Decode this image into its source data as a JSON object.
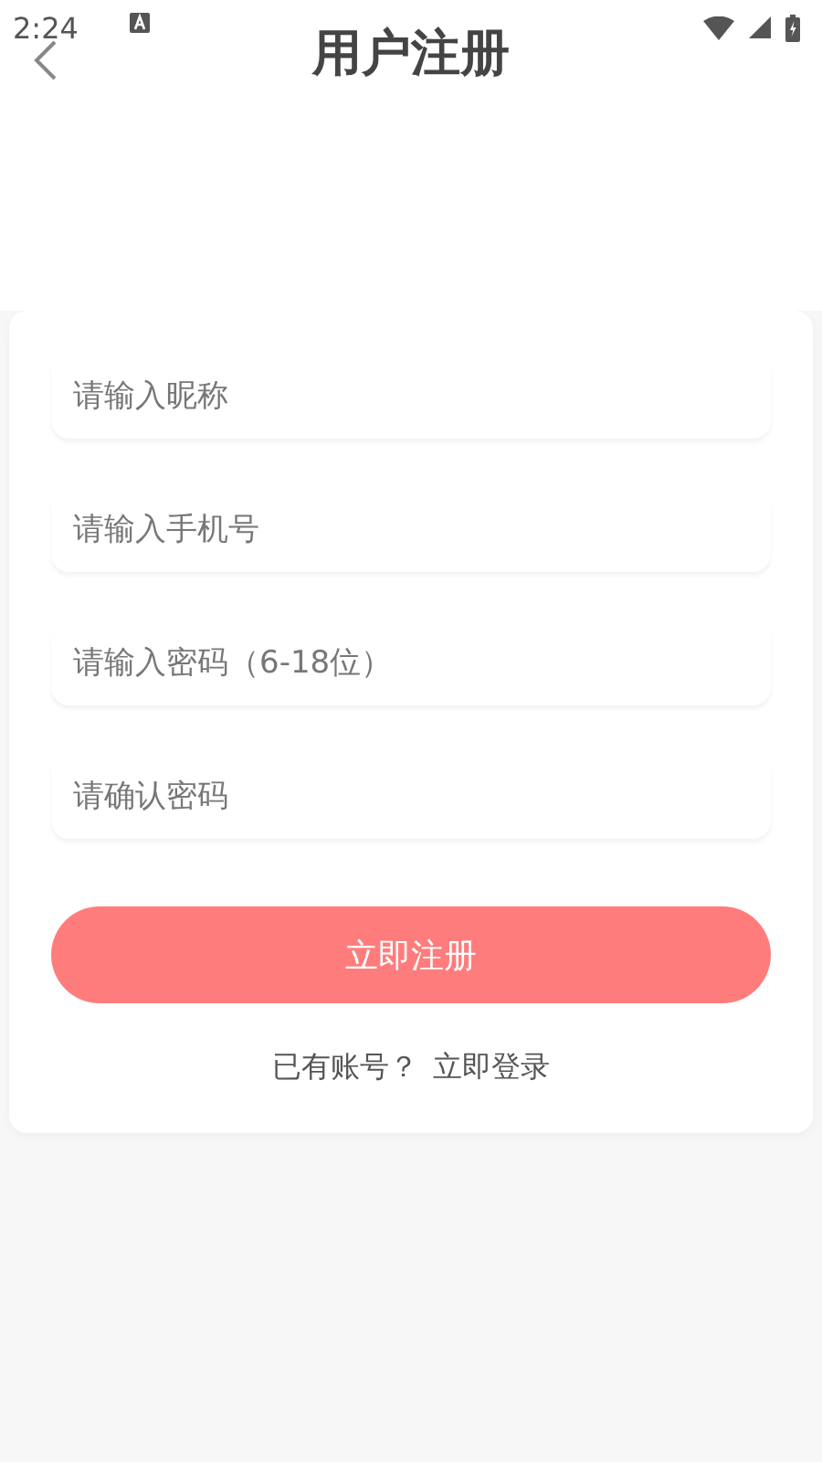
{
  "status_bar": {
    "time": "2:24"
  },
  "header": {
    "title": "用户注册"
  },
  "fields": [
    {
      "placeholder": "请输入昵称"
    },
    {
      "placeholder": "请输入手机号"
    },
    {
      "placeholder": "请输入密码（6-18位）"
    },
    {
      "placeholder": "请确认密码"
    }
  ],
  "submit_button": "立即注册",
  "login_prompt": {
    "text": "已有账号？",
    "link": "立即登录"
  }
}
